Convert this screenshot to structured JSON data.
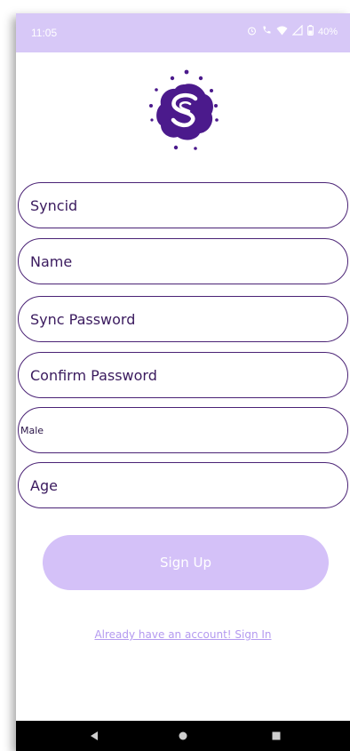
{
  "status_bar": {
    "time": "11:05",
    "battery": "40%",
    "icons": [
      "alarm-icon",
      "call-icon",
      "wifi-icon",
      "signal-icon",
      "battery-icon"
    ],
    "background": "#d7c8f7"
  },
  "app": {
    "logo_icon": "sync-s-logo-icon",
    "brand_color": "#4b1a8c"
  },
  "form": {
    "fields": [
      {
        "name": "syncid",
        "placeholder": "Syncid"
      },
      {
        "name": "name",
        "placeholder": "Name"
      },
      {
        "name": "sync-password",
        "placeholder": "Sync Password"
      },
      {
        "name": "confirm-password",
        "placeholder": "Confirm Password"
      },
      {
        "name": "gender",
        "value": "Male"
      },
      {
        "name": "age",
        "placeholder": "Age"
      }
    ],
    "submit_label": "Sign Up",
    "submit_color": "#d4c1f8",
    "signin_link": "Already have an account! Sign In"
  },
  "nav_bar": {
    "icons": [
      "back-icon",
      "home-icon",
      "recents-icon"
    ]
  }
}
